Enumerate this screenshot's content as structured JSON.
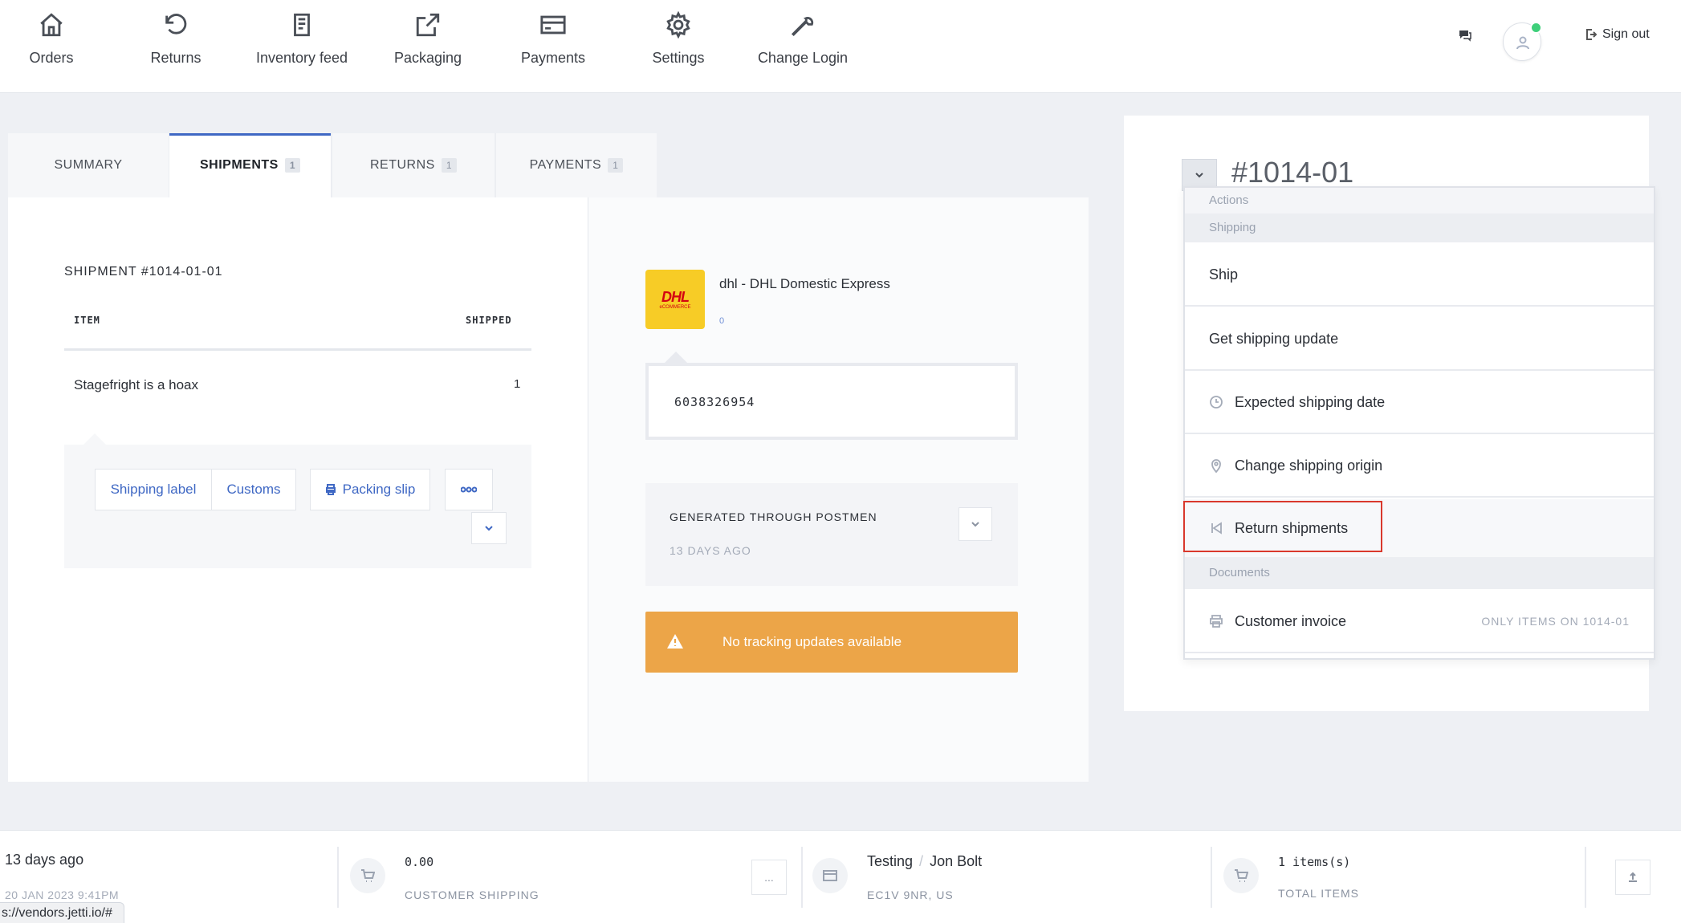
{
  "nav": {
    "items": [
      {
        "label": "Orders",
        "icon": "home-icon"
      },
      {
        "label": "Returns",
        "icon": "undo-icon"
      },
      {
        "label": "Inventory feed",
        "icon": "document-icon"
      },
      {
        "label": "Packaging",
        "icon": "external-link-icon"
      },
      {
        "label": "Payments",
        "icon": "credit-card-icon"
      },
      {
        "label": "Settings",
        "icon": "gear-icon"
      },
      {
        "label": "Change Login",
        "icon": "wrench-icon"
      }
    ],
    "signout_label": "Sign out",
    "online_color": "#3ecf7a"
  },
  "tabs": [
    {
      "label": "SUMMARY",
      "count": ""
    },
    {
      "label": "SHIPMENTS",
      "count": "1"
    },
    {
      "label": "RETURNS",
      "count": "1"
    },
    {
      "label": "PAYMENTS",
      "count": "1"
    }
  ],
  "active_tab": "SHIPMENTS",
  "shipment": {
    "title": "SHIPMENT #1014-01-01",
    "col_item": "ITEM",
    "col_shipped": "SHIPPED",
    "items": [
      {
        "name": "Stagefright is a hoax",
        "qty": "1"
      }
    ],
    "buttons": {
      "shipping_label": "Shipping label",
      "customs": "Customs",
      "packing_slip": "Packing slip"
    }
  },
  "carrier": {
    "logo_text": "DHL",
    "logo_sub": "eCOMMERCE",
    "name": "dhl - DHL Domestic Express",
    "sub": "0",
    "tracking_number": "6038326954",
    "generated_title": "GENERATED THROUGH POSTMEN",
    "generated_ago": "13 DAYS AGO",
    "warning": "No tracking updates available",
    "warning_color": "#eca548"
  },
  "order": {
    "number": "#1014-01",
    "menu": {
      "actions_label": "Actions",
      "shipping_label": "Shipping",
      "items": [
        {
          "label": "Ship",
          "icon": ""
        },
        {
          "label": "Get shipping update",
          "icon": ""
        },
        {
          "label": "Expected shipping date",
          "icon": "clock-icon"
        },
        {
          "label": "Change shipping origin",
          "icon": "location-pin-icon"
        },
        {
          "label": "Return shipments",
          "icon": "skip-back-icon"
        }
      ],
      "documents_label": "Documents",
      "doc_items": [
        {
          "label": "Customer invoice",
          "note": "ONLY ITEMS ON 1014-01",
          "icon": "printer-icon"
        }
      ]
    },
    "highlight_color": "#d9382c"
  },
  "footer": {
    "ago": "13 days ago",
    "date": "20 JAN 2023 9:41PM",
    "shipping_value": "0.00",
    "shipping_caption": "CUSTOMER SHIPPING",
    "more_label": "...",
    "customer_company": "Testing",
    "customer_name": "Jon Bolt",
    "customer_address": "EC1V 9NR, US",
    "items_value": "1 items(s)",
    "items_caption": "TOTAL ITEMS"
  },
  "status_url": "s://vendors.jetti.io/#"
}
